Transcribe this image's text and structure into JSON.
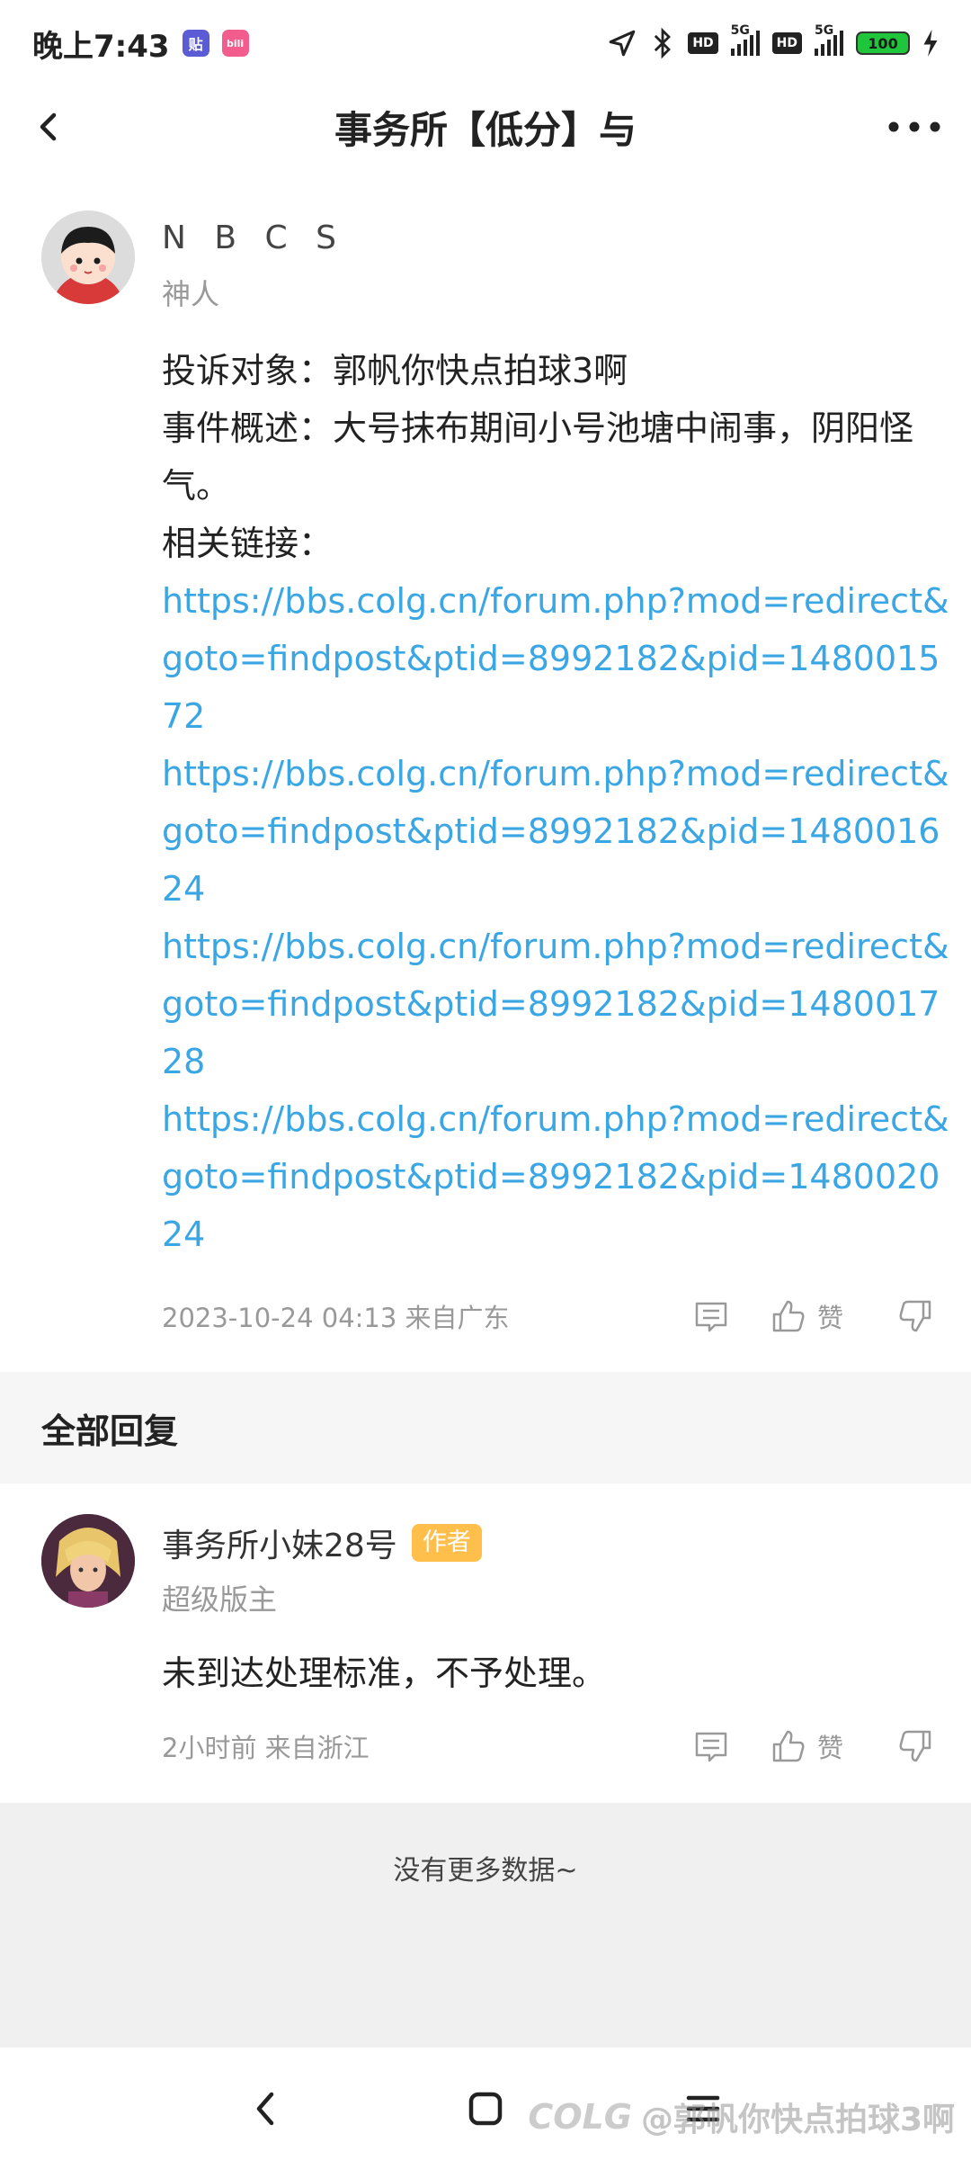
{
  "status_bar": {
    "time": "晚上7:43",
    "app_icon_1": "贴",
    "app_icon_2": "bili",
    "net1": "HD",
    "net2": "HD",
    "sig1_tag": "5G",
    "sig2_tag": "5G",
    "battery": "100"
  },
  "header": {
    "title": "事务所【低分】与"
  },
  "post": {
    "username": "N B C S",
    "user_title": "神人",
    "lines": {
      "target": "投诉对象：郭帆你快点拍球3啊",
      "summary": "事件概述：大号抹布期间小号池塘中闹事，阴阳怪气。",
      "links_label": "相关链接："
    },
    "links": [
      "https://bbs.colg.cn/forum.php?mod=redirect&goto=findpost&ptid=8992182&pid=148001572",
      "https://bbs.colg.cn/forum.php?mod=redirect&goto=findpost&ptid=8992182&pid=148001624",
      "https://bbs.colg.cn/forum.php?mod=redirect&goto=findpost&ptid=8992182&pid=148001728",
      "https://bbs.colg.cn/forum.php?mod=redirect&goto=findpost&ptid=8992182&pid=148002024"
    ],
    "meta": "2023-10-24 04:13  来自广东",
    "like_label": "赞"
  },
  "replies_header": "全部回复",
  "reply": {
    "name": "事务所小妹28号",
    "badge": "作者",
    "role": "超级版主",
    "text": "未到达处理标准，不予处理。",
    "meta": "2小时前 来自浙江",
    "like_label": "赞"
  },
  "footer": {
    "no_more": "没有更多数据~"
  },
  "watermark": {
    "logo": "COLG",
    "text": "@郭帆你快点拍球3啊"
  },
  "colors": {
    "link": "#3aa6e3",
    "author_badge": "#ffbf4a"
  }
}
